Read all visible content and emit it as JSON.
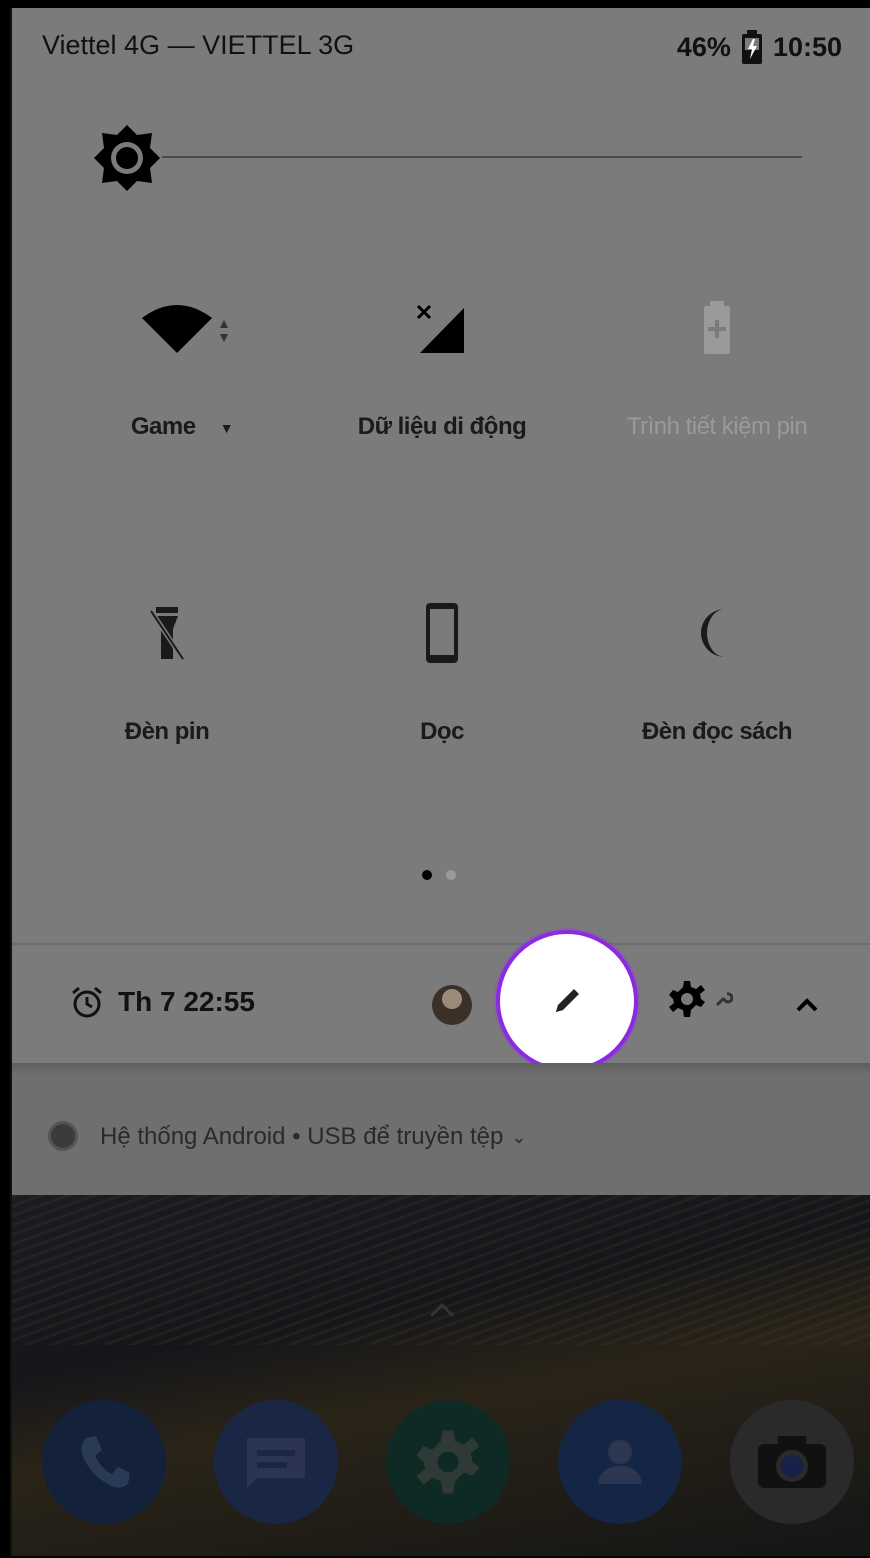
{
  "status_bar": {
    "carrier": "Viettel 4G — VIETTEL 3G",
    "battery": "46%",
    "time": "10:50"
  },
  "tiles": [
    {
      "label": "Game",
      "icon": "wifi-icon",
      "has_dropdown": true
    },
    {
      "label": "Dữ liệu di động",
      "icon": "mobile-data-off-icon"
    },
    {
      "label": "Trình tiết kiệm pin",
      "icon": "battery-saver-icon",
      "dimmed": true
    },
    {
      "label": "Đèn pin",
      "icon": "flashlight-off-icon"
    },
    {
      "label": "Dọc",
      "icon": "portrait-phone-icon"
    },
    {
      "label": "Đèn đọc sách",
      "icon": "night-light-moon-icon"
    }
  ],
  "pager": {
    "pages": 2,
    "current": 1
  },
  "footer": {
    "alarm_time": "Th 7 22:55"
  },
  "notification": {
    "text": "Hệ thống Android • USB để truyền tệp"
  },
  "dock": [
    "phone-icon",
    "messages-icon",
    "settings-icon",
    "contacts-icon",
    "camera-icon"
  ],
  "colors": {
    "panel": "#7b7b7b",
    "highlight_ring": "#8a2be2"
  }
}
